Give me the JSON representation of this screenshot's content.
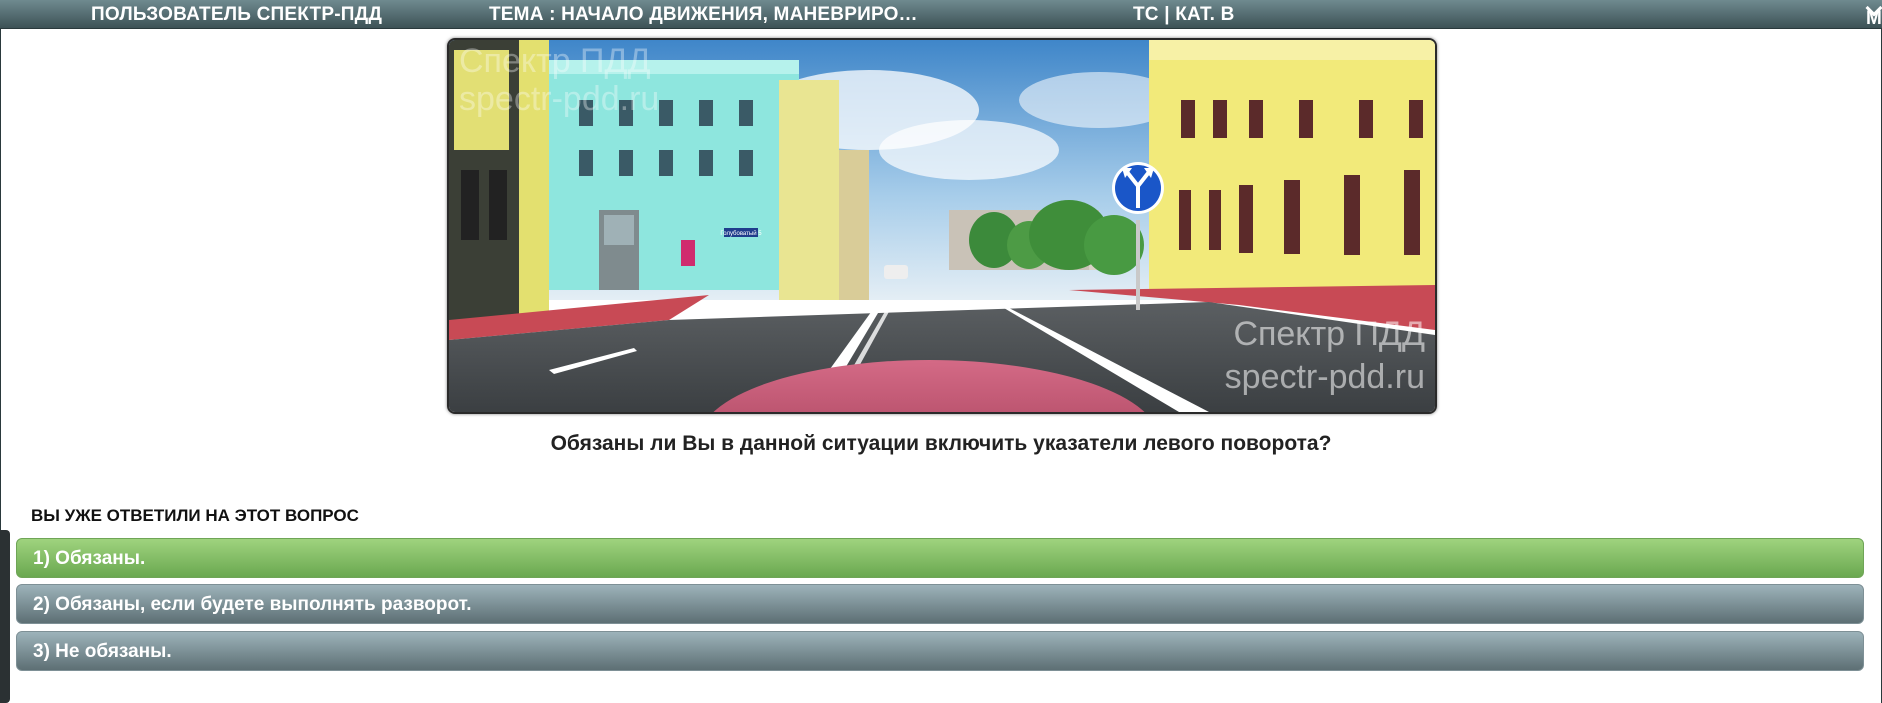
{
  "topbar": {
    "user": "ПОЛЬЗОВАТЕЛЬ СПЕКТР-ПДД",
    "topic": "ТЕМА : НАЧАЛО ДВИЖЕНИЯ, МАНЕВРИРО…",
    "category": "ТС | КАТ. B",
    "menu": "МЕНЮ"
  },
  "photo": {
    "watermark_top_line1": "Спектр ПДД",
    "watermark_top_line2": "spectr-pdd.ru",
    "watermark_bottom_line1": "Спектр ПДД",
    "watermark_bottom_line2": "spectr-pdd.ru",
    "street_sign": "Голубоватый  5",
    "sign_color": "#1a56c8"
  },
  "question": "Обязаны ли Вы в данной ситуации включить указатели левого поворота?",
  "answered_note": "ВЫ УЖЕ ОТВЕТИЛИ НА ЭТОТ ВОПРОС",
  "answers": [
    {
      "label": "1) Обязаны.",
      "state": "correct"
    },
    {
      "label": "2) Обязаны, если будете выполнять разворот.",
      "state": "neutral"
    },
    {
      "label": "3) Не обязаны.",
      "state": "neutral"
    }
  ],
  "colors": {
    "correct": "#7fbf60",
    "neutral": "#7a8d93",
    "topbar": "#4c6266"
  }
}
